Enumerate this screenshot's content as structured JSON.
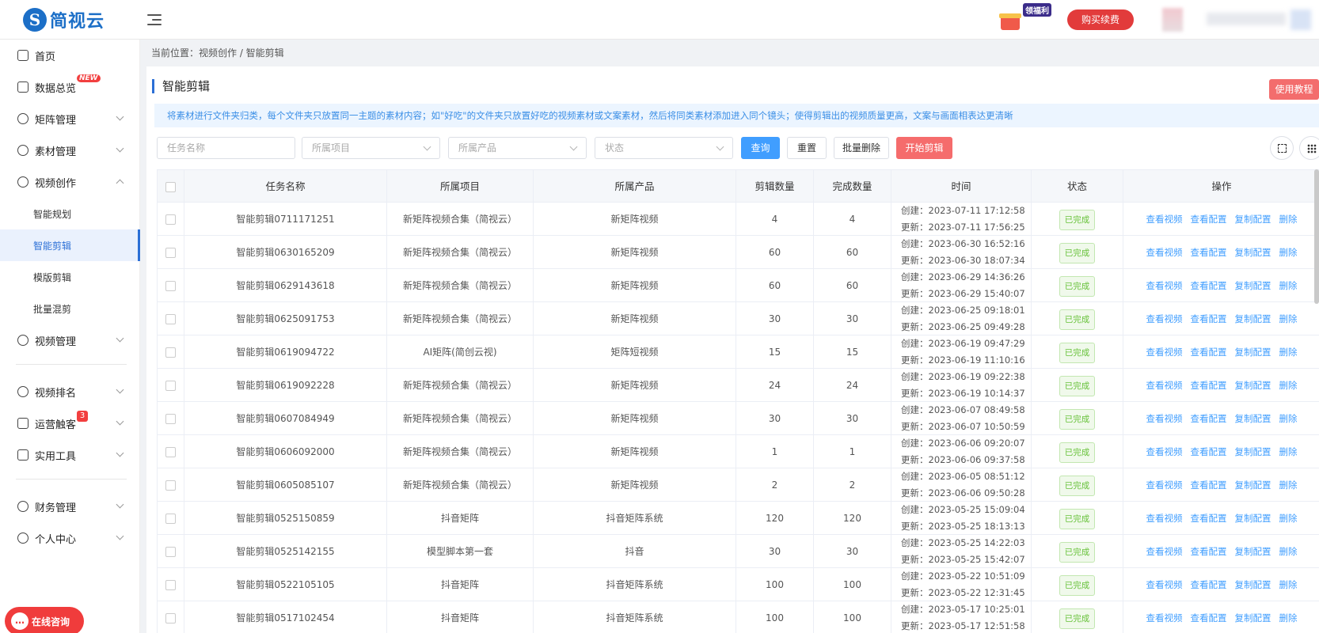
{
  "header": {
    "logo_mark": "S",
    "logo_text": "简视云",
    "gift_badge": "领福利",
    "buy_button": "购买续费"
  },
  "sidebar": {
    "items": [
      {
        "label": "首页",
        "icon": "home-icon"
      },
      {
        "label": "数据总览",
        "icon": "chart-icon",
        "badge": "NEW"
      },
      {
        "label": "矩阵管理",
        "icon": "user-icon"
      },
      {
        "label": "素材管理",
        "icon": "gear-icon"
      },
      {
        "label": "视频创作",
        "icon": "search-icon"
      },
      {
        "label": "视频管理",
        "icon": "chat-icon"
      },
      {
        "label": "视频排名",
        "icon": "gear-icon"
      },
      {
        "label": "运营触客",
        "icon": "building-icon",
        "badge": "3"
      },
      {
        "label": "实用工具",
        "icon": "bar-chart-icon"
      },
      {
        "label": "财务管理",
        "icon": "money-icon"
      },
      {
        "label": "个人中心",
        "icon": "person-icon"
      }
    ],
    "sub_items": [
      "智能规划",
      "智能剪辑",
      "模版剪辑",
      "批量混剪"
    ],
    "chat_button": "在线咨询"
  },
  "breadcrumb": "当前位置：视频创作 / 智能剪辑",
  "page_title": "智能剪辑",
  "tutorial_button": "使用教程",
  "tip": "将素材进行文件夹归类，每个文件夹只放置同一主题的素材内容；如\"好吃\"的文件夹只放置好吃的视频素材或文案素材，然后将同类素材添加进入同个镜头；使得剪辑出的视频质量更高，文案与画面相表达更清晰",
  "filters": {
    "task_name_placeholder": "任务名称",
    "project_placeholder": "所属项目",
    "product_placeholder": "所属产品",
    "status_placeholder": "状态",
    "search": "查询",
    "reset": "重置",
    "batch_delete": "批量删除",
    "start_edit": "开始剪辑"
  },
  "table": {
    "headers": [
      "任务名称",
      "所属项目",
      "所属产品",
      "剪辑数量",
      "完成数量",
      "时间",
      "状态",
      "操作"
    ],
    "create_prefix": "创建：",
    "update_prefix": "更新：",
    "actions": [
      "查看视频",
      "查看配置",
      "复制配置",
      "删除"
    ],
    "rows": [
      {
        "name": "智能剪辑0711171251",
        "project": "新矩阵视频合集（简视云）",
        "product": "新矩阵视频",
        "count": "4",
        "done": "4",
        "created": "2023-07-11 17:12:58",
        "updated": "2023-07-11 17:56:25",
        "status": "已完成"
      },
      {
        "name": "智能剪辑0630165209",
        "project": "新矩阵视频合集（简视云）",
        "product": "新矩阵视频",
        "count": "60",
        "done": "60",
        "created": "2023-06-30 16:52:16",
        "updated": "2023-06-30 18:07:34",
        "status": "已完成"
      },
      {
        "name": "智能剪辑0629143618",
        "project": "新矩阵视频合集（简视云）",
        "product": "新矩阵视频",
        "count": "60",
        "done": "60",
        "created": "2023-06-29 14:36:26",
        "updated": "2023-06-29 15:40:07",
        "status": "已完成"
      },
      {
        "name": "智能剪辑0625091753",
        "project": "新矩阵视频合集（简视云）",
        "product": "新矩阵视频",
        "count": "30",
        "done": "30",
        "created": "2023-06-25 09:18:01",
        "updated": "2023-06-25 09:49:28",
        "status": "已完成"
      },
      {
        "name": "智能剪辑0619094722",
        "project": "AI矩阵(简创云视)",
        "product": "矩阵短视频",
        "count": "15",
        "done": "15",
        "created": "2023-06-19 09:47:29",
        "updated": "2023-06-19 11:10:16",
        "status": "已完成"
      },
      {
        "name": "智能剪辑0619092228",
        "project": "新矩阵视频合集（简视云）",
        "product": "新矩阵视频",
        "count": "24",
        "done": "24",
        "created": "2023-06-19 09:22:38",
        "updated": "2023-06-19 10:14:37",
        "status": "已完成"
      },
      {
        "name": "智能剪辑0607084949",
        "project": "新矩阵视频合集（简视云）",
        "product": "新矩阵视频",
        "count": "30",
        "done": "30",
        "created": "2023-06-07 08:49:58",
        "updated": "2023-06-07 10:50:59",
        "status": "已完成"
      },
      {
        "name": "智能剪辑0606092000",
        "project": "新矩阵视频合集（简视云）",
        "product": "新矩阵视频",
        "count": "1",
        "done": "1",
        "created": "2023-06-06 09:20:07",
        "updated": "2023-06-06 09:37:58",
        "status": "已完成"
      },
      {
        "name": "智能剪辑0605085107",
        "project": "新矩阵视频合集（简视云）",
        "product": "新矩阵视频",
        "count": "2",
        "done": "2",
        "created": "2023-06-05 08:51:12",
        "updated": "2023-06-06 09:50:28",
        "status": "已完成"
      },
      {
        "name": "智能剪辑0525150859",
        "project": "抖音矩阵",
        "product": "抖音矩阵系统",
        "count": "120",
        "done": "120",
        "created": "2023-05-25 15:09:04",
        "updated": "2023-05-25 18:13:13",
        "status": "已完成"
      },
      {
        "name": "智能剪辑0525142155",
        "project": "模型脚本第一套",
        "product": "抖音",
        "count": "30",
        "done": "30",
        "created": "2023-05-25 14:22:03",
        "updated": "2023-05-25 15:42:07",
        "status": "已完成"
      },
      {
        "name": "智能剪辑0522105105",
        "project": "抖音矩阵",
        "product": "抖音矩阵系统",
        "count": "100",
        "done": "100",
        "created": "2023-05-22 10:51:09",
        "updated": "2023-05-22 12:31:45",
        "status": "已完成"
      },
      {
        "name": "智能剪辑0517102454",
        "project": "抖音矩阵",
        "product": "抖音矩阵系统",
        "count": "100",
        "done": "100",
        "created": "2023-05-17 10:25:01",
        "updated": "2023-05-17 12:51:58",
        "status": "已完成"
      }
    ]
  },
  "colors": {
    "primary": "#409eff",
    "brand": "#1c6fc7",
    "danger": "#f56c6c",
    "success": "#67c23a"
  }
}
